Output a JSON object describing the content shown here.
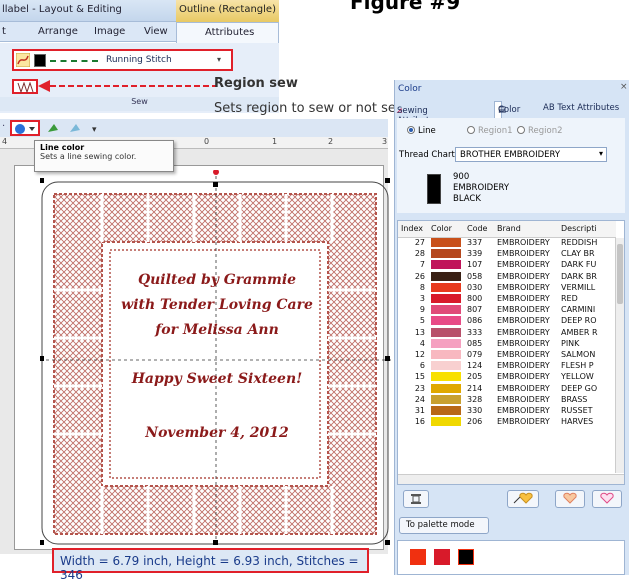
{
  "figure_title": "Figure #9",
  "ribbon": {
    "title_left": "llabel - Layout & Editing",
    "context_tab": "Outline (Rectangle)",
    "tabs": [
      "t",
      "Arrange",
      "Image",
      "View",
      "Attributes"
    ],
    "line_type": "Running Stitch",
    "sew_label": "Sew"
  },
  "callouts": {
    "region_sew": "Region sew",
    "region_desc": "Sets region to sew or not sew."
  },
  "tooltip": {
    "title": "Line color",
    "desc": "Sets a line sewing color."
  },
  "ruler_marks": [
    "4",
    "0",
    "1",
    "2",
    "3"
  ],
  "design_text": {
    "line1": "Quilted by Grammie",
    "line2": "with Tender Loving Care",
    "line3": "for Melissa Ann",
    "line4": "Happy Sweet Sixteen!",
    "line5": "November 4, 2012"
  },
  "status": "Width = 6.79 inch, Height = 6.93 inch, Stitches = 346",
  "color_panel": {
    "title": "Color",
    "tabs": [
      "Sewing Attributes",
      "Color",
      "AB Text Attributes"
    ],
    "radios": [
      "Line",
      "Region1",
      "Region2"
    ],
    "thread_chart_label": "Thread Chart:",
    "thread_chart_value": "BROTHER EMBROIDERY",
    "current_code": "900",
    "current_brand": "EMBROIDERY",
    "current_name": "BLACK",
    "columns": [
      "Index",
      "Color",
      "Code",
      "Brand",
      "Descripti"
    ],
    "rows": [
      {
        "index": "27",
        "color": "#c8501a",
        "code": "337",
        "brand": "EMBROIDERY",
        "desc": "REDDISH"
      },
      {
        "index": "28",
        "color": "#b5471d",
        "code": "339",
        "brand": "EMBROIDERY",
        "desc": "CLAY BR"
      },
      {
        "index": "7",
        "color": "#c0145a",
        "code": "107",
        "brand": "EMBROIDERY",
        "desc": "DARK FU"
      },
      {
        "index": "26",
        "color": "#3a2014",
        "code": "058",
        "brand": "EMBROIDERY",
        "desc": "DARK BR"
      },
      {
        "index": "8",
        "color": "#e83a1e",
        "code": "030",
        "brand": "EMBROIDERY",
        "desc": "VERMILL"
      },
      {
        "index": "3",
        "color": "#d81a2a",
        "code": "800",
        "brand": "EMBROIDERY",
        "desc": "RED"
      },
      {
        "index": "9",
        "color": "#e04a78",
        "code": "807",
        "brand": "EMBROIDERY",
        "desc": "CARMINI"
      },
      {
        "index": "5",
        "color": "#e84a86",
        "code": "086",
        "brand": "EMBROIDERY",
        "desc": "DEEP RO"
      },
      {
        "index": "13",
        "color": "#b8506a",
        "code": "333",
        "brand": "EMBROIDERY",
        "desc": "AMBER R"
      },
      {
        "index": "4",
        "color": "#f5a0c0",
        "code": "085",
        "brand": "EMBROIDERY",
        "desc": "PINK"
      },
      {
        "index": "12",
        "color": "#f8b8c0",
        "code": "079",
        "brand": "EMBROIDERY",
        "desc": "SALMON"
      },
      {
        "index": "6",
        "color": "#f8d0d0",
        "code": "124",
        "brand": "EMBROIDERY",
        "desc": "FLESH P"
      },
      {
        "index": "15",
        "color": "#f8e000",
        "code": "205",
        "brand": "EMBROIDERY",
        "desc": "YELLOW"
      },
      {
        "index": "23",
        "color": "#e0a800",
        "code": "214",
        "brand": "EMBROIDERY",
        "desc": "DEEP GO"
      },
      {
        "index": "24",
        "color": "#c8a030",
        "code": "328",
        "brand": "EMBROIDERY",
        "desc": "BRASS"
      },
      {
        "index": "31",
        "color": "#b86818",
        "code": "330",
        "brand": "EMBROIDERY",
        "desc": "RUSSET"
      },
      {
        "index": "16",
        "color": "#f0d800",
        "code": "206",
        "brand": "EMBROIDERY",
        "desc": "HARVES"
      }
    ],
    "palette_button": "To palette mode",
    "palette_colors": [
      "#f03010",
      "#d81a2a",
      "#000000"
    ]
  }
}
